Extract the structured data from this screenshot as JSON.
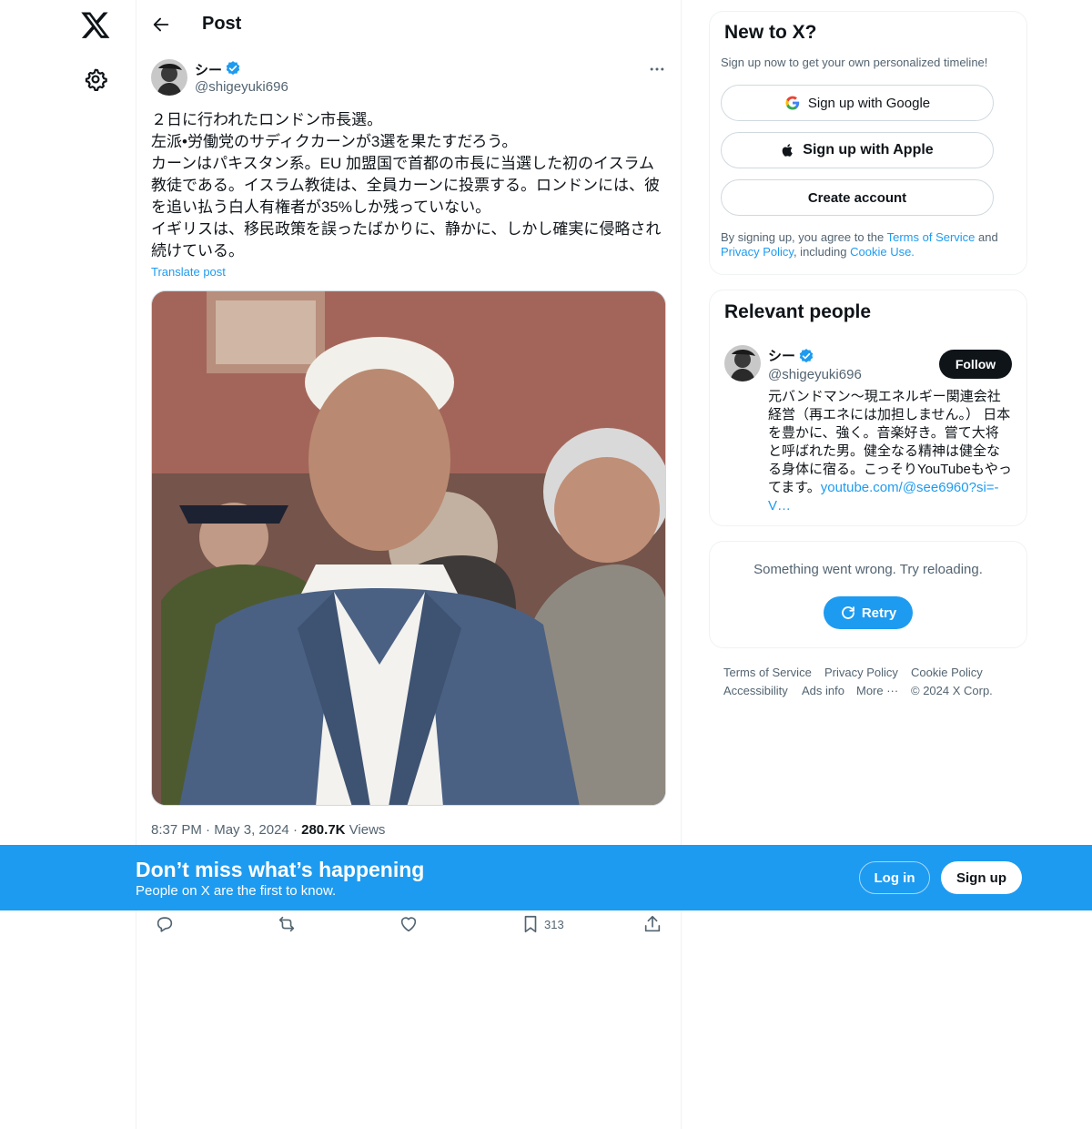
{
  "colors": {
    "accent": "#1d9bf0",
    "text": "#0f1419",
    "muted": "#536471",
    "border": "#eff3f4"
  },
  "nav": {
    "logo_icon": "x-logo-icon",
    "settings_icon": "gear-icon"
  },
  "header": {
    "title": "Post"
  },
  "post": {
    "author_name": "シー",
    "author_handle": "@shigeyuki696",
    "text": "２日に行われたロンドン市長選。\n左派•労働党のサディクカーンが3選を果たすだろう。\nカーンはパキスタン系。EU 加盟国で首都の市長に当選した初のイスラム教徒である。イスラム教徒は、全員カーンに投票する。ロンドンには、彼を追い払う白人有権者が35%しか残っていない。\nイギリスは、移民政策を誤ったばかりに、静かに、しかし確実に侵略され続けている。",
    "translate_label": "Translate post",
    "time": "8:37 PM",
    "date": "May 3, 2024",
    "views_count": "280.7K",
    "views_label": "Views",
    "bookmark_count": "313"
  },
  "signup_card": {
    "title": "New to X?",
    "subtitle": "Sign up now to get your own personalized timeline!",
    "google_label": "Sign up with Google",
    "apple_label": "Sign up with Apple",
    "create_label": "Create account",
    "legal_prefix": "By signing up, you agree to the ",
    "terms_link": "Terms of Service",
    "legal_and": " and ",
    "privacy_link": "Privacy Policy",
    "legal_including": ", including ",
    "cookie_link": "Cookie Use."
  },
  "relevant": {
    "title": "Relevant people",
    "name": "シー",
    "handle": "@shigeyuki696",
    "follow_label": "Follow",
    "bio": "元バンドマン〜現エネルギー関連会社経営（再エネには加担しません。） 日本を豊かに、強く。音楽好き。嘗て大将と呼ばれた男。健全なる精神は健全なる身体に宿る。こっそりYouTubeもやってます。",
    "bio_link": "youtube.com/@see6960?si=-V…"
  },
  "error_card": {
    "message": "Something went wrong. Try reloading.",
    "retry_label": "Retry"
  },
  "footer": {
    "terms": "Terms of Service",
    "privacy": "Privacy Policy",
    "cookie": "Cookie Policy",
    "accessibility": "Accessibility",
    "ads": "Ads info",
    "more": "More ···",
    "copyright": "© 2024 X Corp."
  },
  "banner": {
    "title": "Don’t miss what’s happening",
    "subtitle": "People on X are the first to know.",
    "login_label": "Log in",
    "signup_label": "Sign up"
  }
}
